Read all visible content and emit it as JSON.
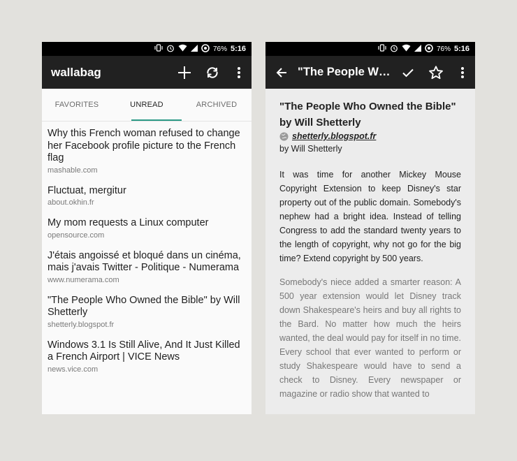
{
  "status": {
    "battery": "76%",
    "time": "5:16"
  },
  "left": {
    "app_title": "wallabag",
    "tabs": [
      {
        "label": "FAVORITES"
      },
      {
        "label": "UNREAD"
      },
      {
        "label": "ARCHIVED"
      }
    ],
    "articles": [
      {
        "title": "Why this French woman refused to change her Facebook profile picture to the French flag",
        "source": "mashable.com"
      },
      {
        "title": "Fluctuat, mergitur",
        "source": "about.okhin.fr"
      },
      {
        "title": "My mom requests a Linux computer",
        "source": "opensource.com"
      },
      {
        "title": "J'étais angoissé et bloqué dans un cinéma, mais j'avais Twitter - Politique - Numerama",
        "source": "www.numerama.com"
      },
      {
        "title": "\"The People Who Owned the Bible\" by Will Shetterly",
        "source": "shetterly.blogspot.fr"
      },
      {
        "title": "Windows 3.1 Is Still Alive, And It Just Killed a French Airport | VICE News",
        "source": "news.vice.com"
      }
    ]
  },
  "right": {
    "appbar_title": "\"The People Wh...",
    "article": {
      "title": "\"The People Who Owned the Bible\" by Will Shetterly",
      "link": "shetterly.blogspot.fr",
      "author": "by Will Shetterly",
      "para1": "It was time for another Mickey Mouse Copyright Extension to keep Disney's star property out of the public domain. Somebody's nephew had a bright idea. Instead of telling Congress to add the standard twenty years to the length of copyright, why not go for the big time? Extend copyright by 500 years.",
      "para2": "Somebody's niece added a smarter reason: A 500 year extension would let Disney track down Shakespeare's heirs and buy all rights to the Bard. No matter how much the heirs wanted, the deal would pay for itself in no time. Every school that ever wanted to perform or study Shakespeare would have to send a check to Disney. Every newspaper or magazine or radio show that wanted to"
    }
  }
}
